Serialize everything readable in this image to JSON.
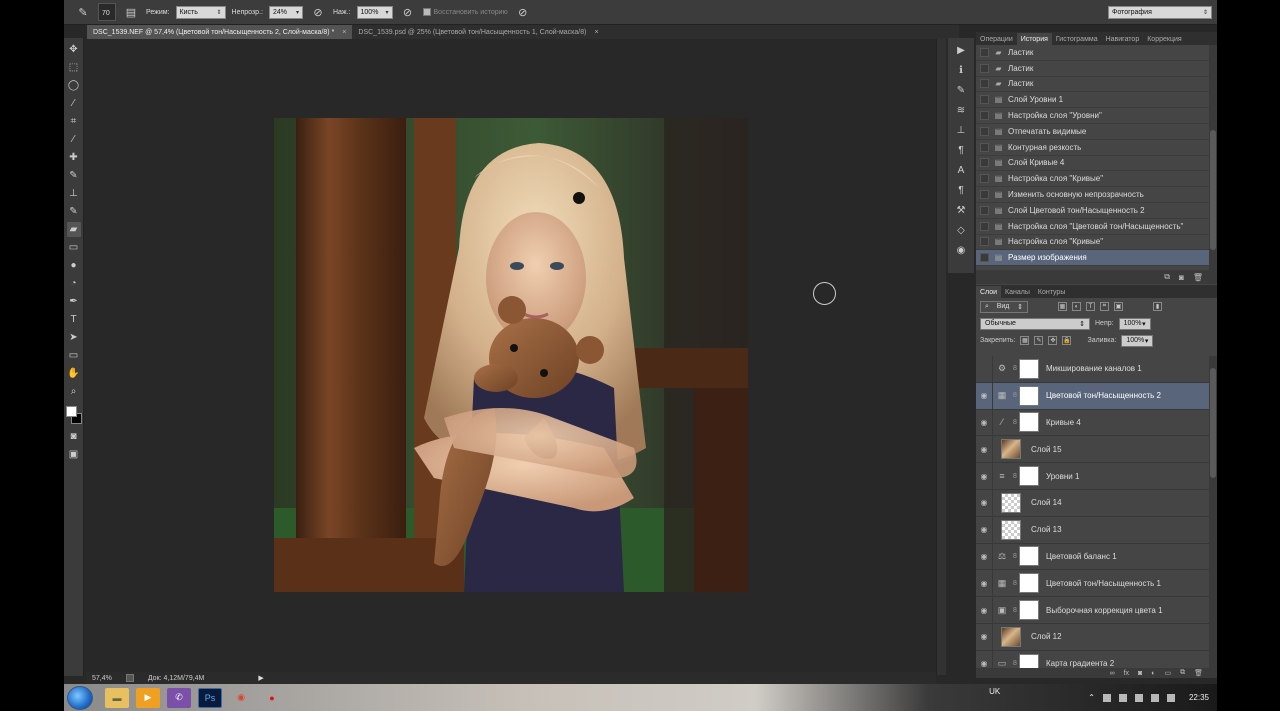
{
  "options_bar": {
    "brush_size": "70",
    "mode_label": "Режим:",
    "mode_value": "Кисть",
    "opacity_label": "Непрозр.:",
    "opacity_value": "24%",
    "flow_label": "Наж.:",
    "flow_value": "100%",
    "restore_history_label": "Восстановить историю",
    "workspace_value": "Фотография"
  },
  "tabs": [
    {
      "label": "DSC_1539.NEF @ 57,4% (Цветовой тон/Насыщенность 2, Слой-маска/8) *",
      "close": "×"
    },
    {
      "label": "DSC_1539.psd @ 25% (Цветовой тон/Насыщенность 1, Слой-маска/8)",
      "close": "×"
    }
  ],
  "status": {
    "zoom": "57,4%",
    "doc_size": "Док: 4,12M/79,4M"
  },
  "history_panel": {
    "tabs": [
      "Операции",
      "История",
      "Гистограмма",
      "Навигатор",
      "Коррекция"
    ],
    "active_tab": "История",
    "items": [
      "Ластик",
      "Ластик",
      "Ластик",
      "Слой Уровни 1",
      "Настройка слоя \"Уровни\"",
      "Отпечатать видимые",
      "Контурная резкость",
      "Слой Кривые 4",
      "Настройка слоя \"Кривые\"",
      "Изменить основную непрозрачность",
      "Слой Цветовой тон/Насыщенность 2",
      "Настройка слоя \"Цветовой тон/Насыщенность\"",
      "Настройка слоя \"Кривые\"",
      "Размер изображения"
    ]
  },
  "layers_panel": {
    "tabs": [
      "Слои",
      "Каналы",
      "Контуры"
    ],
    "active_tab": "Слои",
    "filter_value": "Вид",
    "blend_mode": "Обычные",
    "opacity_label": "Непр:",
    "opacity_value": "100%",
    "lock_label": "Закрепить:",
    "fill_label": "Заливка:",
    "fill_value": "100%",
    "layers": [
      {
        "name": "Микширование каналов 1",
        "visible": false
      },
      {
        "name": "Цветовой тон/Насыщенность 2",
        "visible": true
      },
      {
        "name": "Кривые 4",
        "visible": true
      },
      {
        "name": "Слой 15",
        "visible": true
      },
      {
        "name": "Уровни 1",
        "visible": true
      },
      {
        "name": "Слой 14",
        "visible": true
      },
      {
        "name": "Слой 13",
        "visible": true
      },
      {
        "name": "Цветовой баланс 1",
        "visible": true
      },
      {
        "name": "Цветовой тон/Насыщенность 1",
        "visible": true
      },
      {
        "name": "Выборочная коррекция цвета 1",
        "visible": true
      },
      {
        "name": "Слой 12",
        "visible": true
      },
      {
        "name": "Карта градиента 2",
        "visible": true
      }
    ]
  },
  "taskbar": {
    "lang": "UK",
    "time": "22:35"
  }
}
